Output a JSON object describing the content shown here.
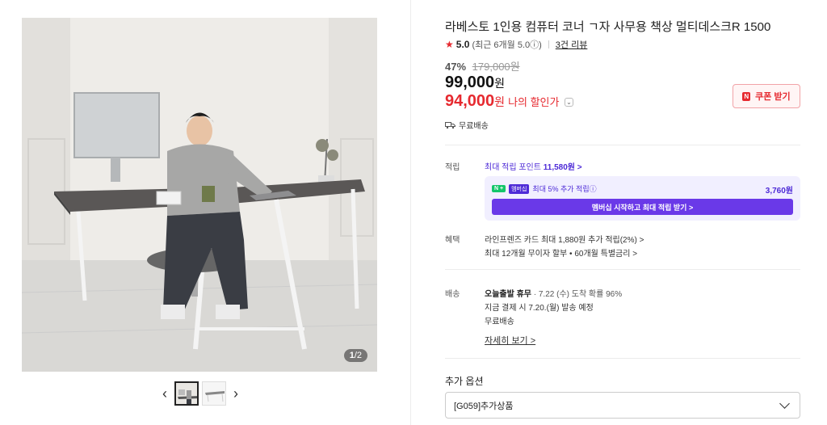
{
  "gallery": {
    "page_current": "1",
    "page_total": "/2",
    "prev_icon": "chevron-left-icon",
    "next_icon": "chevron-right-icon"
  },
  "product": {
    "title": "라베스토 1인용 컴퓨터 코너 ㄱ자 사무용 책상 멀티데스크R 1500",
    "rating": "5.0",
    "rating_sub": "(최근 6개월 5.0ⓘ)",
    "reviews": "3건 리뷰",
    "discount_pct": "47%",
    "original_price": "179,000원",
    "price": "99,000",
    "price_unit": "원",
    "my_price": "94,000",
    "my_price_unit": "원",
    "my_price_label": "나의 할인가",
    "coupon_label": "쿠폰 받기",
    "coupon_logo": "N",
    "free_shipping": "무료배송"
  },
  "points": {
    "label": "적립",
    "max_point_text": "최대 적립 포인트",
    "max_point_value": "11,580원 >",
    "member_badge": "N +",
    "member_badge2": "멤버십",
    "member_extra": "최대 5% 추가 적립ⓘ",
    "member_amount": "3,760원",
    "member_cta": "멤버십 시작하고 최대 적립 받기 >"
  },
  "benefits": {
    "label": "혜택",
    "line1": "라인프렌즈 카드 최대 1,880원 추가 적립(2%) >",
    "line2": "최대 12개월 무이자 할부 • 60개월 특별금리 >"
  },
  "shipping": {
    "label": "배송",
    "line1_bold": "오늘출발 휴무",
    "line1_rest": " · 7.22 (수) 도착 확률 96%",
    "line2": "지금 결제 시 7.20.(월) 발송 예정",
    "line3": "무료배송",
    "detail_link": "자세히 보기 >"
  },
  "options": {
    "label": "추가 옵션",
    "selected": "[G059]추가상품"
  },
  "colors": {
    "accent_red": "#e6292f",
    "accent_purple": "#4e2bd7",
    "member_button": "#6a39e8"
  }
}
